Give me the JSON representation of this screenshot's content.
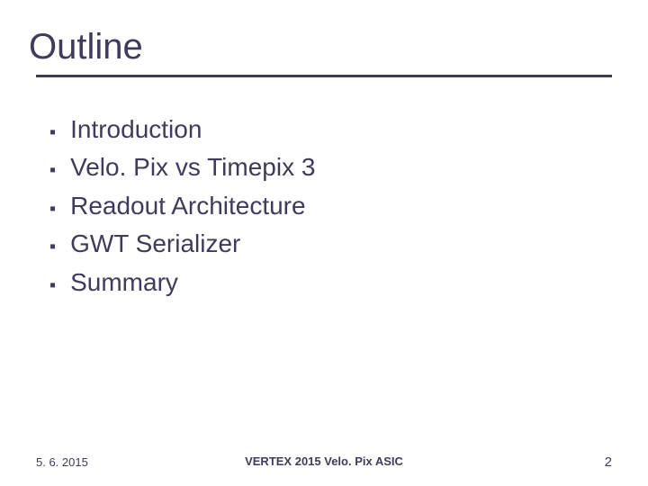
{
  "title": "Outline",
  "bullets": [
    "Introduction",
    "Velo. Pix vs Timepix 3",
    "Readout Architecture",
    "GWT Serializer",
    "Summary"
  ],
  "footer": {
    "date": "5. 6. 2015",
    "center": "VERTEX 2015 Velo. Pix ASIC",
    "page": "2"
  }
}
